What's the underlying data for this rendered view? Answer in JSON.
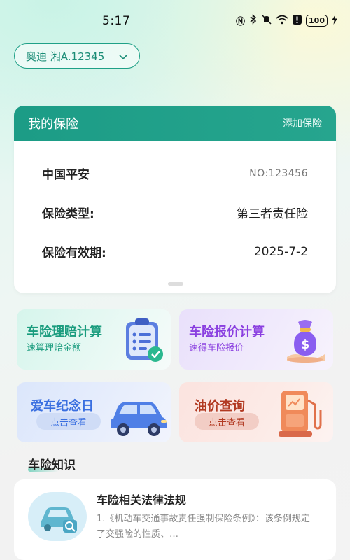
{
  "status_bar": {
    "time": "5:17",
    "battery": "100",
    "icons": [
      "nfc-icon",
      "bluetooth-icon",
      "mute-icon",
      "wifi-icon",
      "alert-icon",
      "battery-icon",
      "charging-icon"
    ]
  },
  "car_selector": {
    "label": "奥迪 湘A.12345"
  },
  "insurance": {
    "title": "我的保险",
    "add_label": "添加保险",
    "company": "中国平安",
    "policy_no": "NO:123456",
    "type_label": "保险类型:",
    "type_value": "第三者责任险",
    "validity_label": "保险有效期:",
    "validity_value": "2025-7-2"
  },
  "tiles": {
    "claim": {
      "title": "车险理赔计算",
      "subtitle": "速算理赔金额",
      "icon": "clipboard-check-icon"
    },
    "quote": {
      "title": "车险报价计算",
      "subtitle": "速得车险报价",
      "icon": "money-bag-icon"
    },
    "anniversary": {
      "title": "爱车纪念日",
      "button": "点击查看",
      "icon": "suv-car-icon"
    },
    "oil": {
      "title": "油价查询",
      "button": "点击查看",
      "icon": "fuel-pump-icon"
    }
  },
  "knowledge": {
    "section_title": "车险知识",
    "item_title": "车险相关法律法规",
    "item_desc": "1.《机动车交通事故责任强制保险条例》：该条例规定了交强险的性质、…",
    "thumb_icon": "car-search-icon"
  },
  "colors": {
    "brand": "#1c9c86",
    "claim_title": "#1a9c7e",
    "quote_title": "#8a3fe0",
    "anniversary_title": "#3a6fe0",
    "oil_title": "#b23a22"
  }
}
